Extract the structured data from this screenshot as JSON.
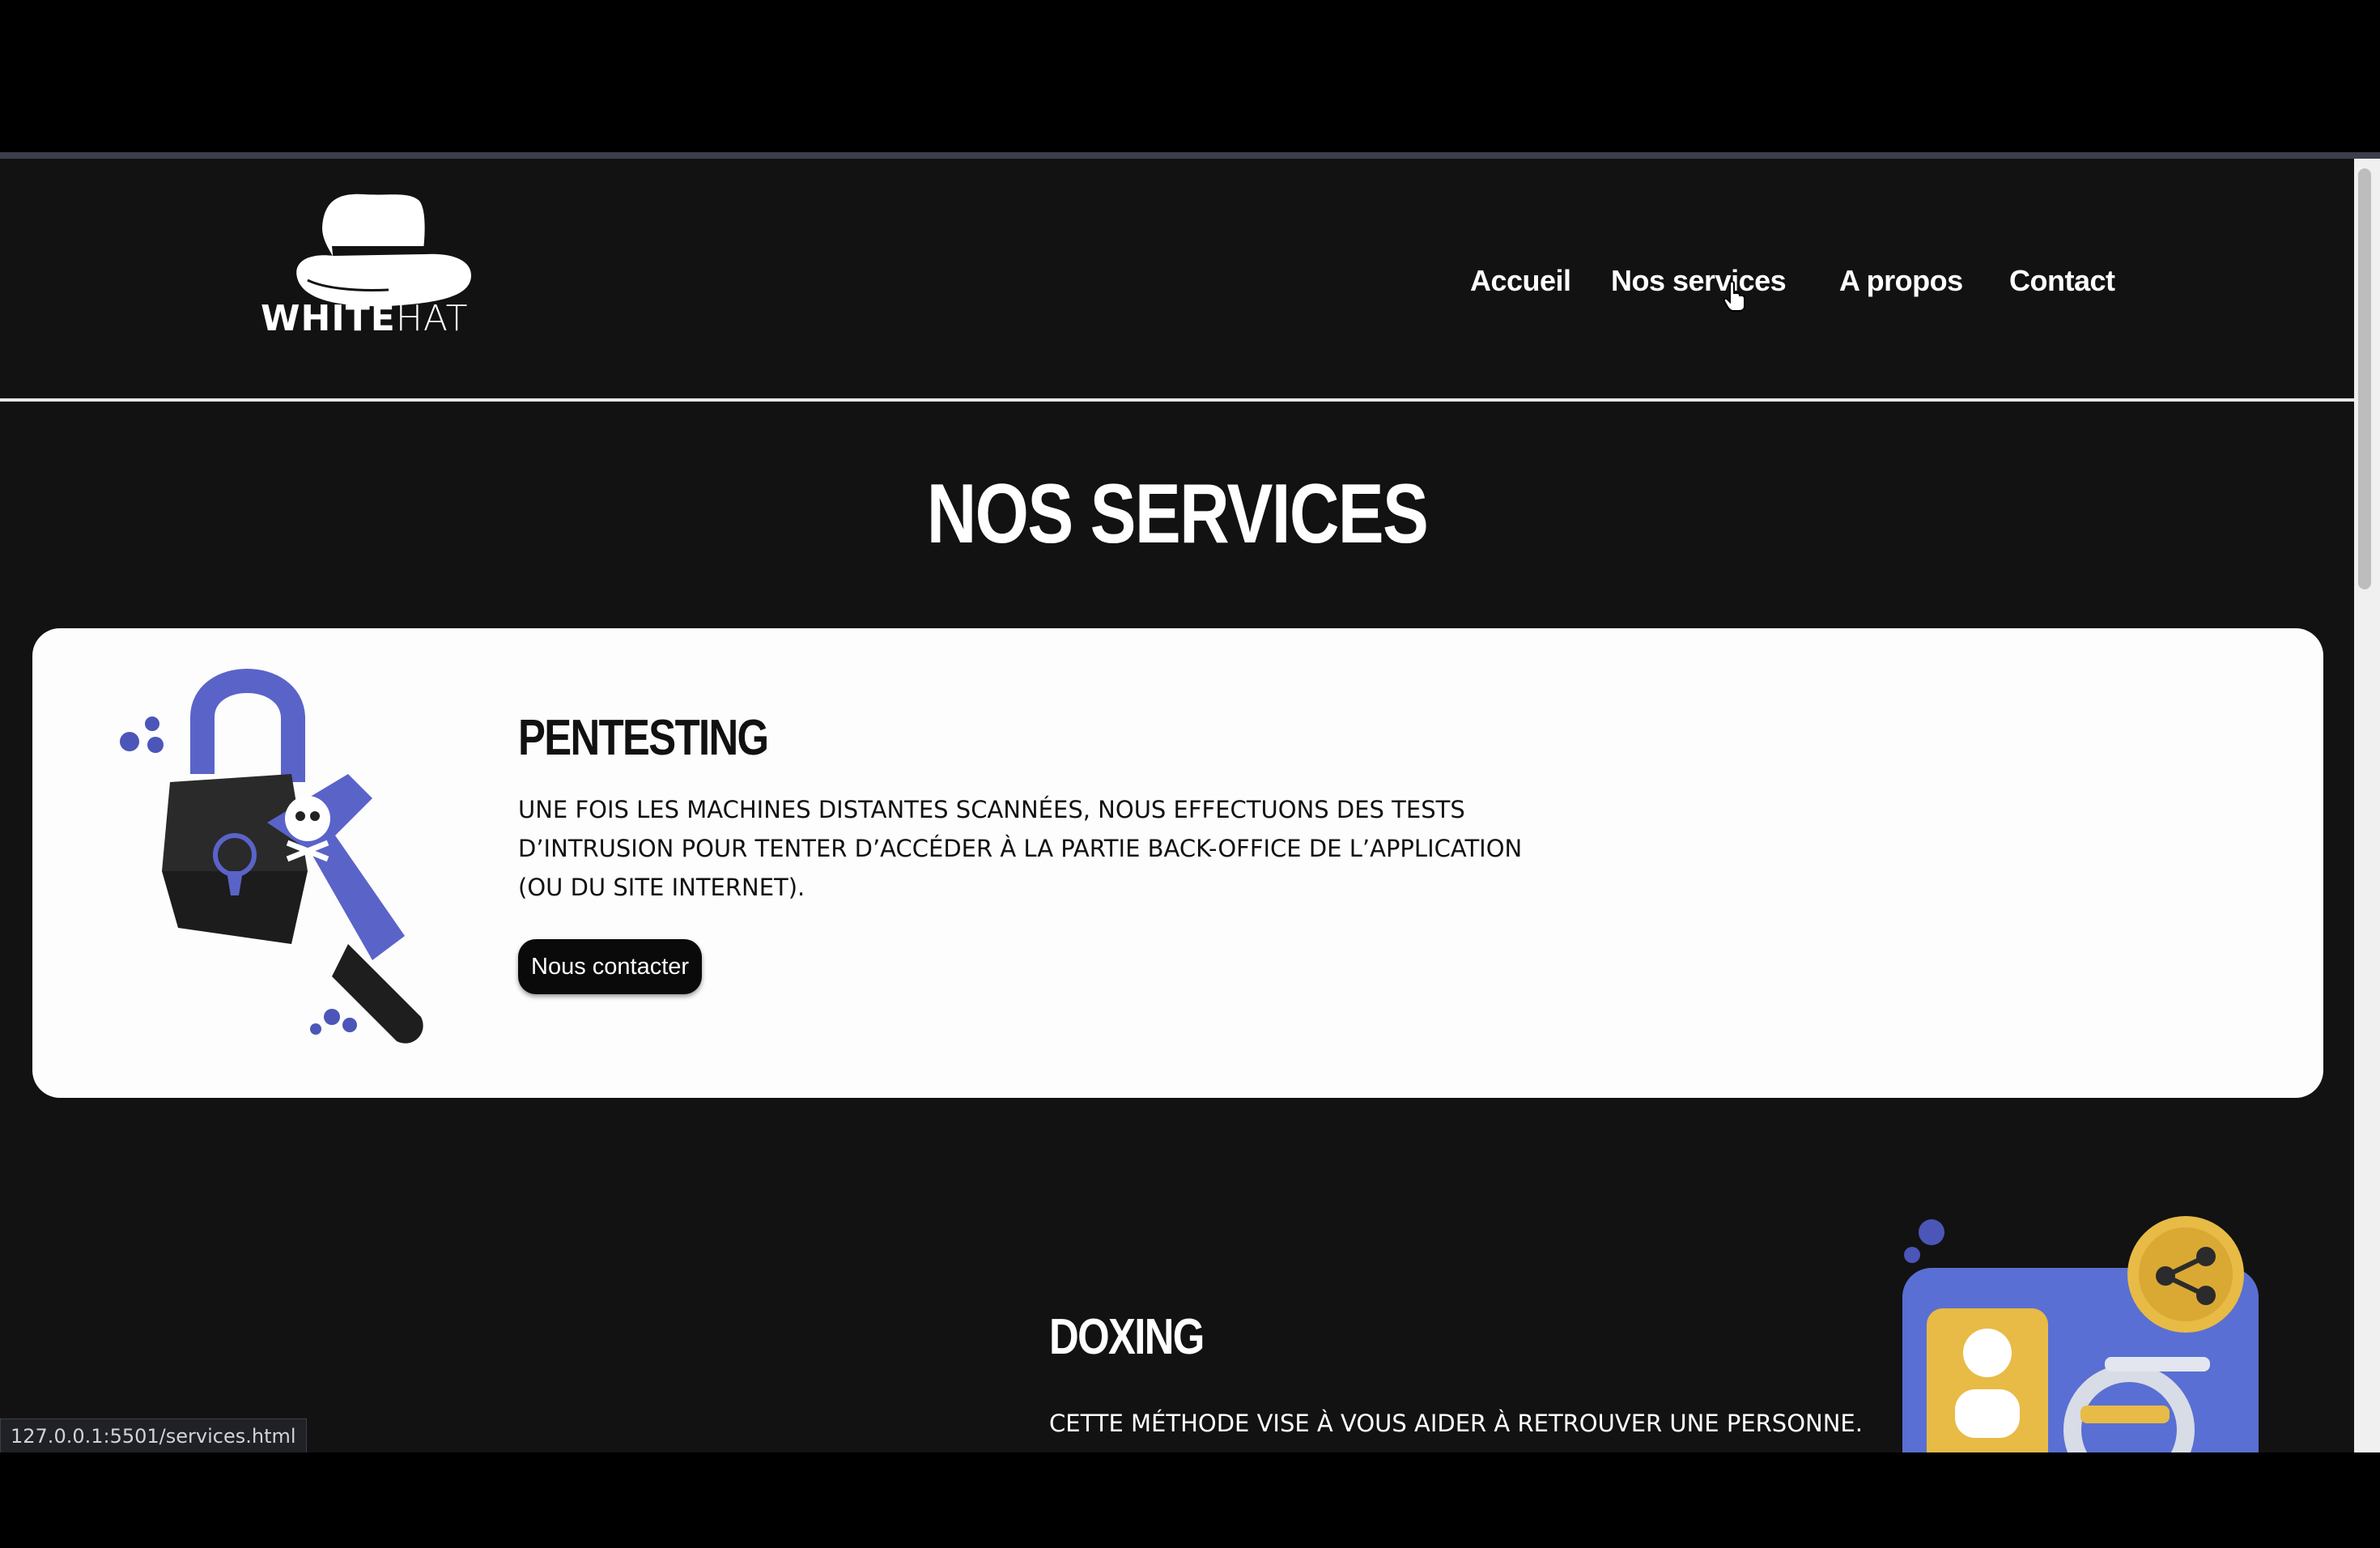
{
  "logo": {
    "brand_bold": "WHITE",
    "brand_light": "HAT"
  },
  "nav": {
    "items": [
      {
        "label": "Accueil"
      },
      {
        "label": "Nos services"
      },
      {
        "label": "A propos"
      },
      {
        "label": "Contact"
      }
    ],
    "hovered": "Nos services"
  },
  "page": {
    "title": "NOS SERVICES"
  },
  "services": [
    {
      "title": "PENTESTING",
      "description": "Une fois les machines distantes scannées, nous effectuons des tests d’intrusion pour tenter d’accéder à la partie back-office de l’application (ou du site internet).",
      "button_label": "Nous contacter",
      "illustration": "broken-padlock-icon"
    },
    {
      "title": "DOXING",
      "description": "Cette méthode vise à vous aider à retrouver une personne.",
      "illustration": "id-card-share-icon"
    }
  ],
  "status_bar": {
    "url": "127.0.0.1:5501/services.html"
  },
  "colors": {
    "background": "#121212",
    "card": "#fdfdfd",
    "accent": "#5a63c8",
    "gold": "#e7bb45"
  }
}
